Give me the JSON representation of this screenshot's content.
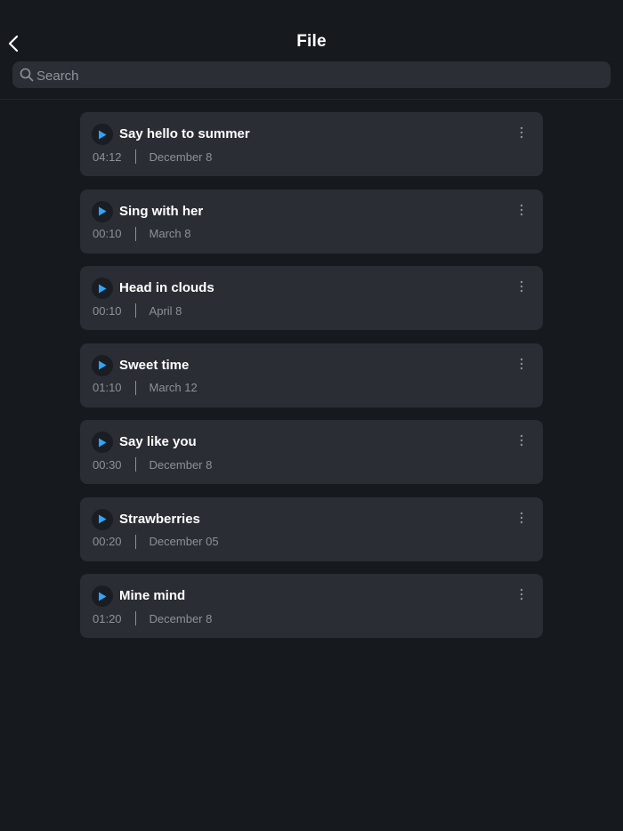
{
  "header": {
    "title": "File",
    "back_icon": "chevron-left-icon"
  },
  "search": {
    "placeholder": "Search",
    "value": "",
    "icon": "search-icon"
  },
  "colors": {
    "background": "#16191d",
    "card": "#2a2d33",
    "search_bg": "#2b2f35",
    "accent": "#2ea6ff",
    "secondary_text": "#8d9198"
  },
  "recordings": [
    {
      "title": "Say hello to summer",
      "duration": "04:12",
      "date": "December 8"
    },
    {
      "title": "Sing with her",
      "duration": "00:10",
      "date": "March 8"
    },
    {
      "title": "Head in clouds",
      "duration": "00:10",
      "date": "April 8"
    },
    {
      "title": "Sweet time",
      "duration": "01:10",
      "date": "March 12"
    },
    {
      "title": "Say like you",
      "duration": "00:30",
      "date": "December 8"
    },
    {
      "title": "Strawberries",
      "duration": "00:20",
      "date": "December 05"
    },
    {
      "title": "Mine mind",
      "duration": "01:20",
      "date": "December 8"
    }
  ]
}
